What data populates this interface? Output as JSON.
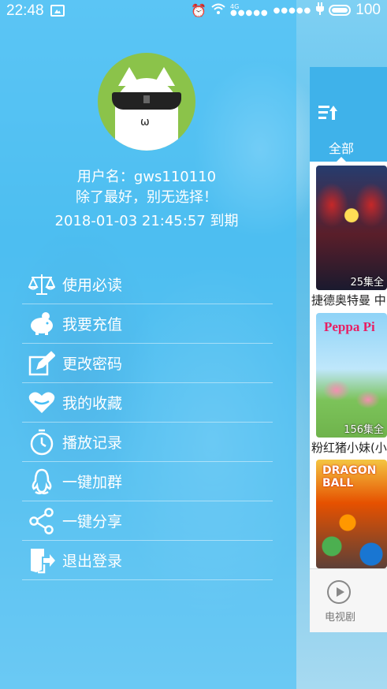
{
  "status_bar": {
    "time": "22:48",
    "network": "4G",
    "battery": "100"
  },
  "user": {
    "name_line": "用户名：gws110110",
    "motto": "除了最好，别无选择！",
    "expiry_line": "2018-01-03 21:45:57 到期"
  },
  "menu": {
    "items": [
      {
        "label": "使用必读",
        "icon": "scale-icon"
      },
      {
        "label": "我要充值",
        "icon": "piggy-bank-icon"
      },
      {
        "label": "更改密码",
        "icon": "edit-icon"
      },
      {
        "label": "我的收藏",
        "icon": "heart-icon"
      },
      {
        "label": "播放记录",
        "icon": "timer-icon"
      },
      {
        "label": "一键加群",
        "icon": "qq-icon"
      },
      {
        "label": "一键分享",
        "icon": "share-icon"
      },
      {
        "label": "退出登录",
        "icon": "logout-icon"
      }
    ]
  },
  "main": {
    "filter_tab": "全部",
    "cards": [
      {
        "title": "捷德奥特曼 中",
        "episodes": "25集全"
      },
      {
        "title": "粉红猪小妹(小",
        "episodes": "156集全",
        "poster_text": "Peppa Pi"
      },
      {
        "title": "",
        "episodes": "",
        "poster_text": "DRAGON BALL"
      }
    ],
    "bottom_nav": {
      "tv_label": "电视剧"
    }
  },
  "colors": {
    "drawer_blue": "#46bef5",
    "header_blue": "#3fb2ea",
    "avatar_green": "#8bc34a"
  }
}
